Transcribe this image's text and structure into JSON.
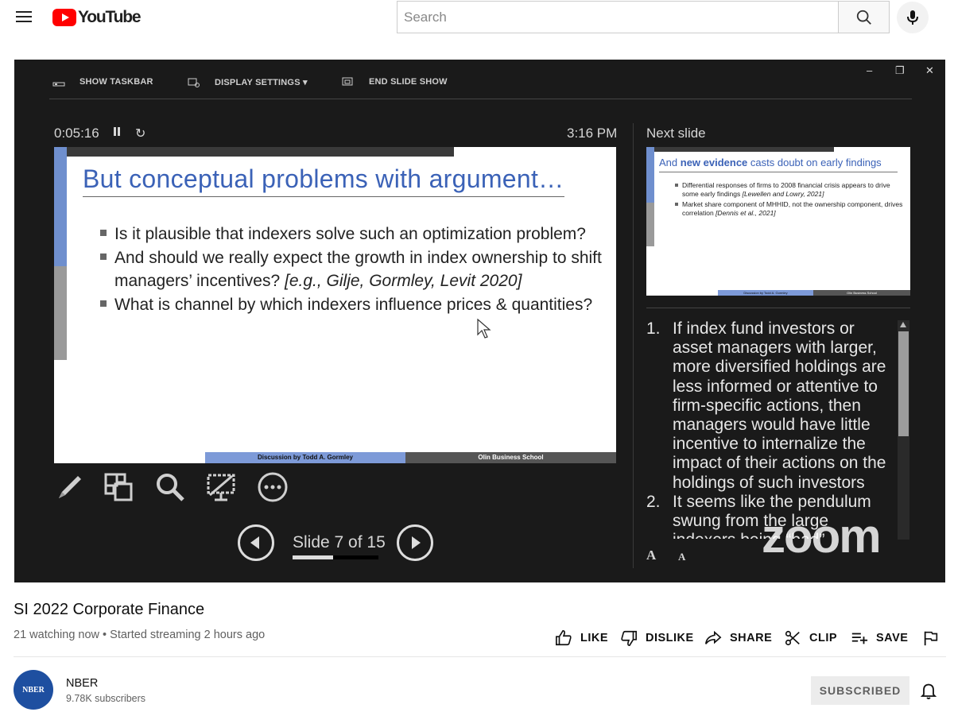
{
  "header": {
    "logo_text": "YouTube",
    "search_placeholder": "Search"
  },
  "presenter": {
    "toolbar": {
      "show_taskbar": "SHOW TASKBAR",
      "display_settings": "DISPLAY SETTINGS ▾",
      "end_slide_show": "END SLIDE SHOW"
    },
    "window_controls": {
      "minimize": "–",
      "restore": "❐",
      "close": "✕"
    },
    "timer": "0:05:16",
    "clock": "3:16 PM",
    "current_slide": {
      "title": "But conceptual problems with argument…",
      "bullets": [
        {
          "text": "Is it plausible that indexers solve such an optimization problem?",
          "cite": ""
        },
        {
          "text": "And should we really expect the growth in index ownership to shift managers’ incentives? ",
          "cite": "[e.g., Gilje, Gormley, Levit 2020]"
        },
        {
          "text": "What is channel by which indexers influence prices & quantities?",
          "cite": ""
        }
      ],
      "footer_left": "Discussion by Todd A. Gormley",
      "footer_right": "Olin Business School"
    },
    "slide_counter": "Slide 7 of 15",
    "slide_progress": 0.47,
    "next_label": "Next slide",
    "next_slide": {
      "title_pre": "And ",
      "title_bold": "new evidence",
      "title_post": " casts doubt on early findings",
      "bullets": [
        {
          "text": "Differential responses of firms to 2008 financial crisis appears to drive some early findings ",
          "cite": "[Lewellen and Lowry, 2021]"
        },
        {
          "text": "Market share component of MHHID, not the ownership component, drives correlation ",
          "cite": "[Dennis et al., 2021]"
        }
      ],
      "footer_left": "Discussion by Todd A. Gormley",
      "footer_right": "Olin Business School"
    },
    "notes": [
      {
        "num": "1.",
        "text": "If index fund investors or asset managers with larger, more diversified holdings are less informed or attentive to firm-specific actions, then managers would have little incentive to internalize the impact of their actions on the holdings of such investors"
      },
      {
        "num": "2.",
        "text": "It seems like the pendulum swung from the large indexers being “bad”"
      }
    ],
    "font_increase": "A",
    "font_decrease": "A",
    "watermark": "zoom"
  },
  "video": {
    "title": "SI 2022 Corporate Finance",
    "meta": "21 watching now • Started streaming 2 hours ago"
  },
  "actions": {
    "like": "LIKE",
    "dislike": "DISLIKE",
    "share": "SHARE",
    "clip": "CLIP",
    "save": "SAVE"
  },
  "channel": {
    "avatar_text": "NBER",
    "name": "NBER",
    "subscribers": "9.78K subscribers",
    "subscribe_state": "SUBSCRIBED"
  },
  "colors": {
    "youtube_red": "#ff0000",
    "slide_title_blue": "#3b62b7",
    "avatar_blue": "#1e4fa0"
  },
  "icons": [
    "menu-icon",
    "search-icon",
    "mic-icon",
    "pen-icon",
    "slides-grid-icon",
    "magnifier-icon",
    "screen-icon",
    "more-icon",
    "like-icon",
    "dislike-icon",
    "share-icon",
    "clip-icon",
    "save-playlist-icon",
    "flag-icon",
    "bell-icon"
  ]
}
